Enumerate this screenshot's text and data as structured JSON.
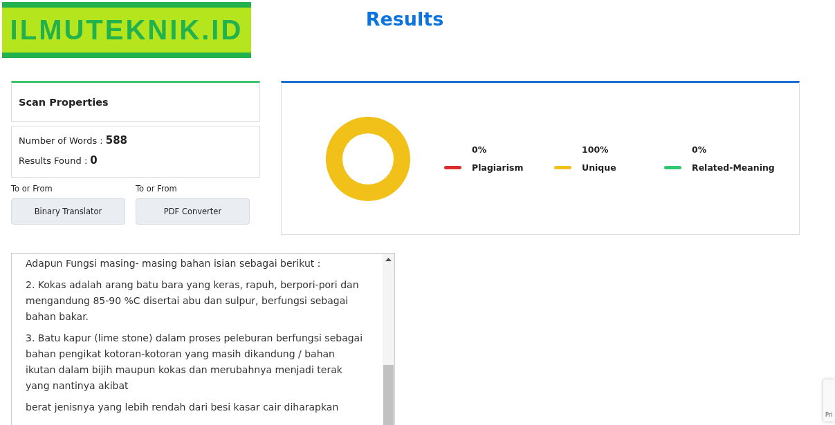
{
  "logo": {
    "text": "ILMUTEKNIK.ID"
  },
  "header": {
    "title": "Results"
  },
  "scan_properties": {
    "title": "Scan Properties",
    "stats": [
      {
        "label": "Number of Words :",
        "value": "588"
      },
      {
        "label": "Results Found :",
        "value": "0"
      }
    ]
  },
  "tools": [
    {
      "caption": "To or From",
      "button": "Binary Translator"
    },
    {
      "caption": "To or From",
      "button": "PDF Converter"
    }
  ],
  "results_card": {
    "chart_data": {
      "type": "donut",
      "categories": [
        "Plagiarism",
        "Unique",
        "Related-Meaning"
      ],
      "values": [
        0,
        100,
        0
      ],
      "value_labels": [
        "0%",
        "100%",
        "0%"
      ],
      "colors": [
        "#dd2c2c",
        "#f1c11a",
        "#33c870"
      ]
    }
  },
  "text_box": {
    "paragraphs": [
      "Adapun Fungsi masing- masing bahan isian sebagai berikut :",
      "2. Kokas adalah arang batu bara yang keras, rapuh, berpori-pori dan mengandung 85-90 %C disertai abu dan sulpur, berfungsi sebagai bahan bakar.",
      "3. Batu kapur (lime stone) dalam proses peleburan berfungsi sebagai bahan pengikat kotoran-kotoran yang masih dikandung / bahan ikutan dalam bijih maupun kokas dan merubahnya menjadi terak yang nantinya akibat",
      "berat jenisnya yang lebih rendah dari besi kasar cair diharapkan"
    ]
  },
  "corner_badge": {
    "text": "Pri"
  }
}
